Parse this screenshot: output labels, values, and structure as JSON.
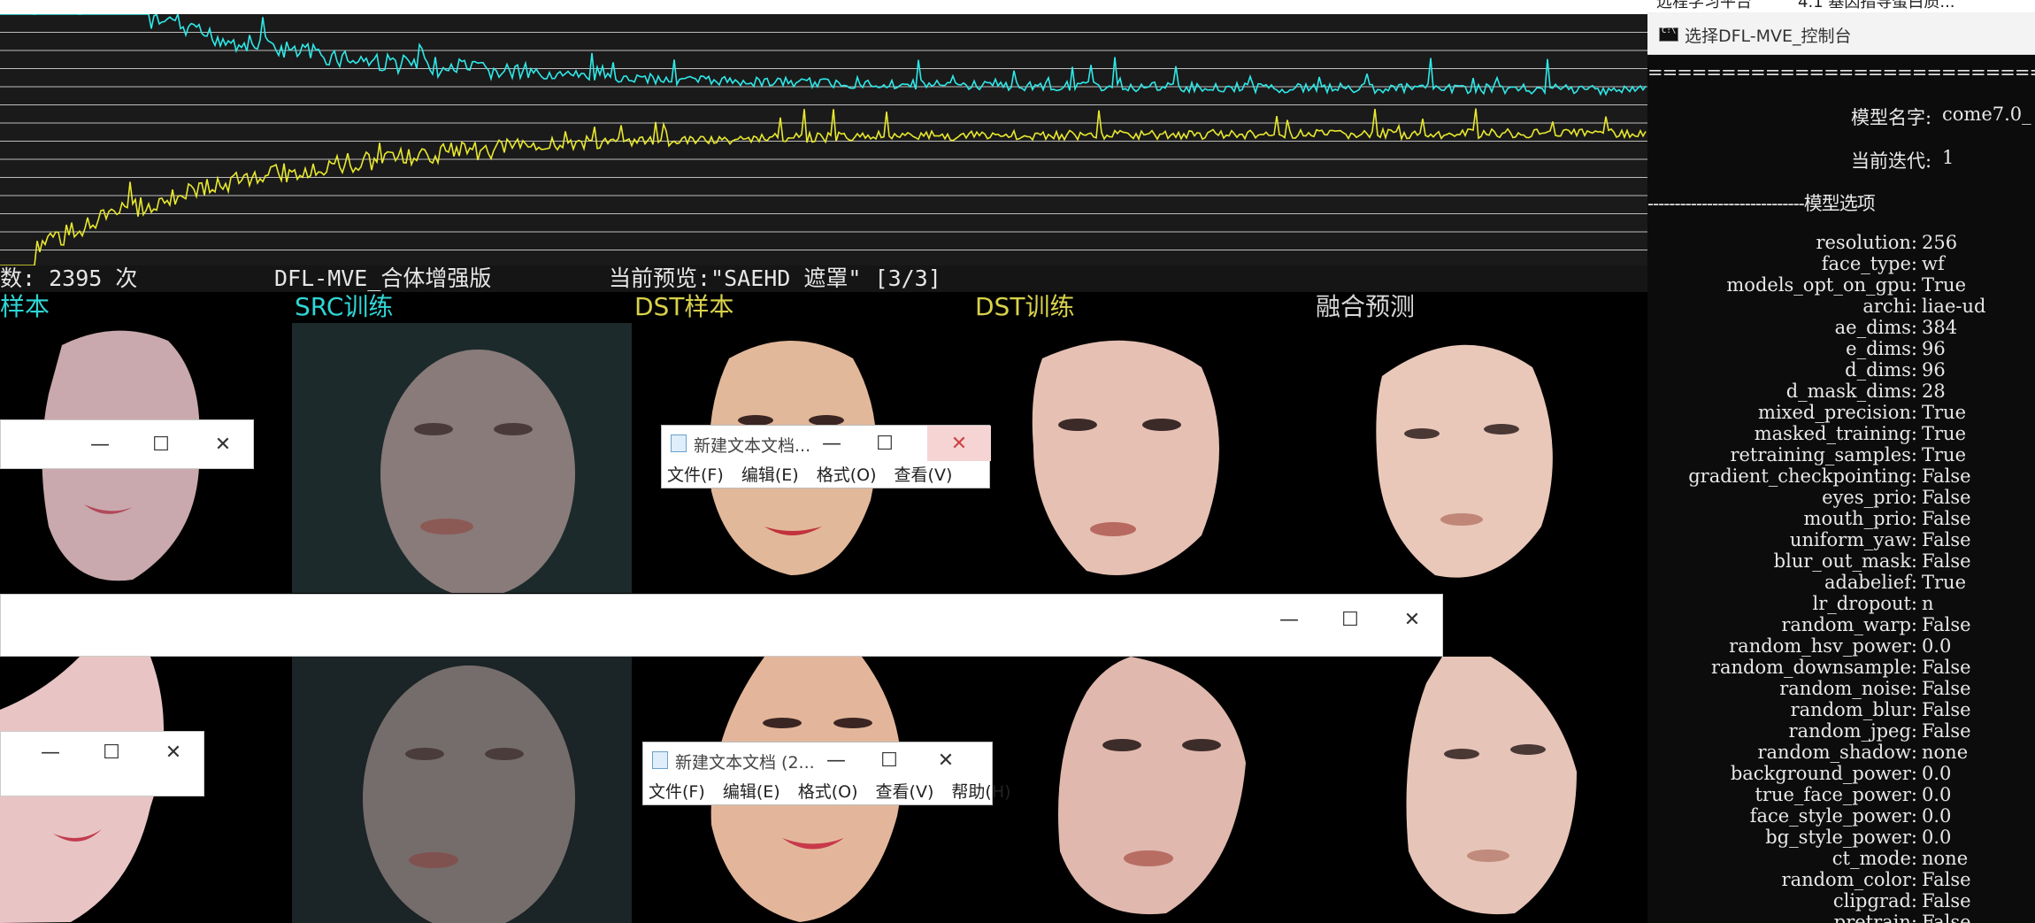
{
  "preview": {
    "status": {
      "iterations": "数: 2395 次",
      "app_name": "DFL-MVE_合体增强版",
      "current_preview": "当前预览:\"SAEHD 遮罩\" [3/3]"
    },
    "columns": [
      {
        "label": "样本",
        "color": "#2fd6d6"
      },
      {
        "label": "SRC训练",
        "color": "#2fd6d6"
      },
      {
        "label": "DST样本",
        "color": "#d9d24a"
      },
      {
        "label": "DST训练",
        "color": "#d9d24a"
      },
      {
        "label": "融合预测",
        "color": "#d8d8d8"
      }
    ],
    "loss_colors": {
      "src": "#2ee8e8",
      "dst": "#e8e82e"
    }
  },
  "notepad_top": {
    "title": "新建文本文档...",
    "menu": [
      "文件(F)",
      "编辑(E)",
      "格式(O)",
      "查看(V)"
    ]
  },
  "notepad_bottom": {
    "title": "新建文本文档 (2...",
    "menu": [
      "文件(F)",
      "编辑(E)",
      "格式(O)",
      "查看(V)",
      "帮助(H)"
    ]
  },
  "caption_glyphs": {
    "minimize": "—",
    "maximize": "☐",
    "close": "✕"
  },
  "browser_tabs": [
    "远程学习平台",
    "4.1 基因指导蛋白质..."
  ],
  "console": {
    "title": "选择DFL-MVE_控制台",
    "summary_header": "==============================模型概",
    "model_name_label": "模型名字:",
    "model_name_value": "come7.0_",
    "iteration_label": "当前迭代:",
    "iteration_value": "1",
    "options_header": "-----------------------------模型选项",
    "options": [
      {
        "key": "resolution:",
        "value": "256"
      },
      {
        "key": "face_type:",
        "value": "wf"
      },
      {
        "key": "models_opt_on_gpu:",
        "value": "True"
      },
      {
        "key": "archi:",
        "value": "liae-ud"
      },
      {
        "key": "ae_dims:",
        "value": "384"
      },
      {
        "key": "e_dims:",
        "value": "96"
      },
      {
        "key": "d_dims:",
        "value": "96"
      },
      {
        "key": "d_mask_dims:",
        "value": "28"
      },
      {
        "key": "mixed_precision:",
        "value": "True"
      },
      {
        "key": "masked_training:",
        "value": "True"
      },
      {
        "key": "retraining_samples:",
        "value": "True"
      },
      {
        "key": "gradient_checkpointing:",
        "value": "False"
      },
      {
        "key": "eyes_prio:",
        "value": "False"
      },
      {
        "key": "mouth_prio:",
        "value": "False"
      },
      {
        "key": "uniform_yaw:",
        "value": "False"
      },
      {
        "key": "blur_out_mask:",
        "value": "False"
      },
      {
        "key": "adabelief:",
        "value": "True"
      },
      {
        "key": "lr_dropout:",
        "value": "n"
      },
      {
        "key": "random_warp:",
        "value": "False"
      },
      {
        "key": "random_hsv_power:",
        "value": "0.0"
      },
      {
        "key": "random_downsample:",
        "value": "False"
      },
      {
        "key": "random_noise:",
        "value": "False"
      },
      {
        "key": "random_blur:",
        "value": "False"
      },
      {
        "key": "random_jpeg:",
        "value": "False"
      },
      {
        "key": "random_shadow:",
        "value": "none"
      },
      {
        "key": "background_power:",
        "value": "0.0"
      },
      {
        "key": "true_face_power:",
        "value": "0.0"
      },
      {
        "key": "face_style_power:",
        "value": "0.0"
      },
      {
        "key": "bg_style_power:",
        "value": "0.0"
      },
      {
        "key": "ct_mode:",
        "value": "none"
      },
      {
        "key": "random_color:",
        "value": "False"
      },
      {
        "key": "clipgrad:",
        "value": "False"
      },
      {
        "key": "pretrain:",
        "value": "False"
      }
    ]
  }
}
